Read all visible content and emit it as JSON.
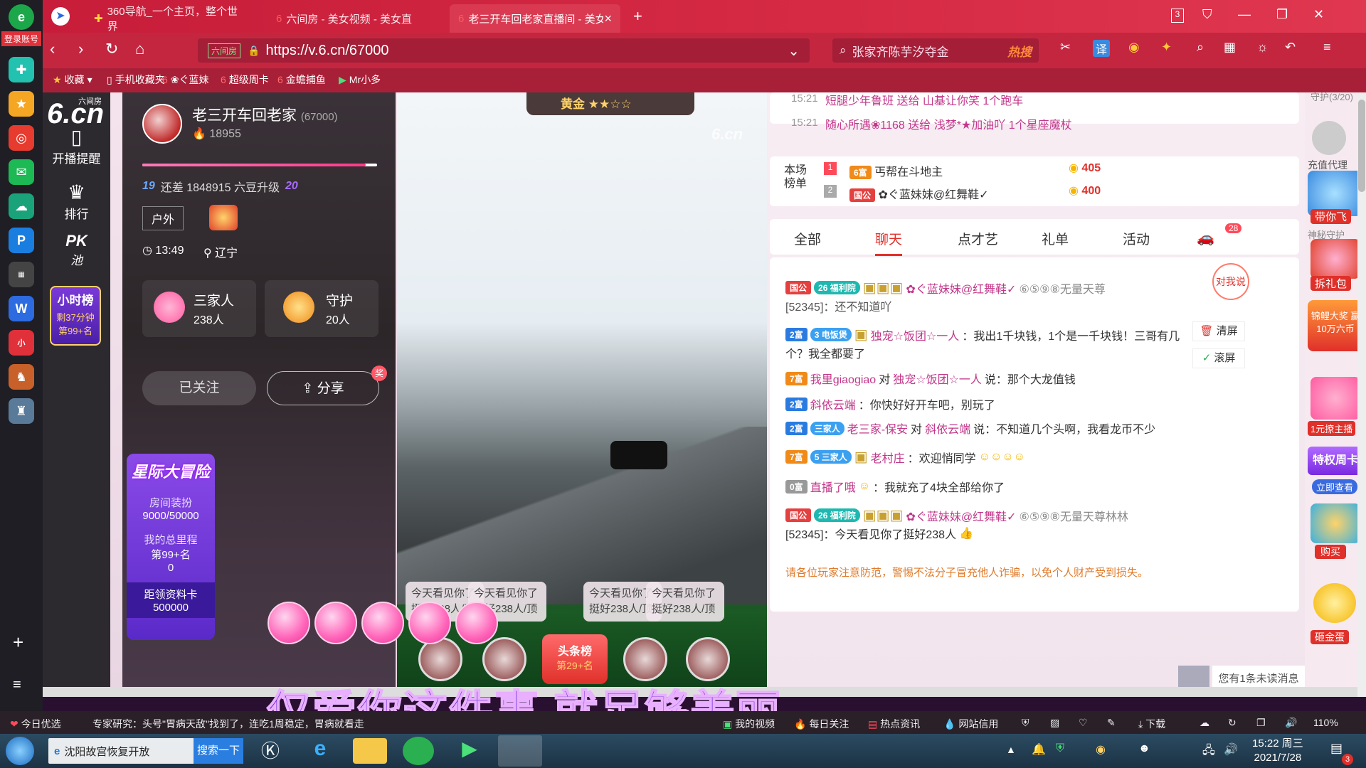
{
  "browser": {
    "login_label": "登录账号",
    "tabs": [
      {
        "label": "360导航_一个主页，整个世界"
      },
      {
        "label": "六间房 - 美女视频 - 美女直"
      },
      {
        "label": "老三开车回老家直播间 - 美女",
        "active": true
      }
    ],
    "tab_count": "3",
    "url_tag": "六间房",
    "url": "https://v.6.cn/67000",
    "search_text": "张家齐陈芋汐夺金",
    "search_hot": "热搜",
    "bookmarks": [
      "收藏",
      "手机收藏夹",
      "❀ぐ蓝妹",
      "超级周卡",
      "金蟾捕鱼",
      "Mr小多"
    ]
  },
  "sidenav": {
    "logo_small": "六间房",
    "logo": "6.cn",
    "items": [
      "开播提醒",
      "排行",
      "PK",
      "池"
    ],
    "hour_rank": {
      "title": "小时榜",
      "remaining": "剩37分钟",
      "rank": "第99+名"
    }
  },
  "anchor": {
    "name": "老三开车回老家",
    "room_id": "(67000)",
    "fans_count": "18955",
    "level_from": "19",
    "level_text": "还差 1848915 六豆升级",
    "level_to": "20",
    "tag": "户外",
    "time": "13:49",
    "location": "辽宁",
    "family": {
      "label": "三家人",
      "count": "238人"
    },
    "guard": {
      "label": "守护",
      "count": "20人"
    },
    "follow_label": "已关注",
    "share_label": "分享",
    "share_badge": "奖"
  },
  "adventure": {
    "title": "星际大冒险",
    "deco_label": "房间装扮",
    "deco_value": "9000/50000",
    "mileage_label": "我的总里程",
    "mileage_rank": "第99+名",
    "mileage_value": "0",
    "card_label": "距领资料卡",
    "card_value": "500000"
  },
  "video": {
    "rank_label": "黄金",
    "watermark": "6.cn",
    "bubbles": [
      "今天看见你了挺好238人/顶",
      "今天看见你了挺好238人/顶",
      "今天看见你了挺好238人/顶",
      "今天看见你了挺好238人/顶"
    ],
    "headline_label": "头条榜",
    "headline_rank": "第29+名",
    "lyric": "仅爱你这件事 就足够美丽"
  },
  "gift_log": [
    {
      "time": "15:21",
      "text": "短腿少年鲁班 送给 山基让你笑 1个跑车"
    },
    {
      "time": "15:21",
      "text": "随心所遇❀1168 送给 浅梦*★加油吖 1个星座魔杖"
    }
  ],
  "leaderboard": {
    "title": "本场榜单",
    "rows": [
      {
        "rank": "1",
        "badge": "6富",
        "name": "丐帮在斗地主",
        "score": "405"
      },
      {
        "rank": "2",
        "badge": "国公",
        "name": "✿ぐ蓝妹妹@红舞鞋✓",
        "score": "400"
      }
    ]
  },
  "chat_tabs": [
    {
      "label": "全部"
    },
    {
      "label": "聊天",
      "active": true
    },
    {
      "label": "点才艺"
    },
    {
      "label": "礼单"
    },
    {
      "label": "活动"
    }
  ],
  "chat_tab_badge": "28",
  "chat_tools": {
    "talk": "对我说",
    "clear": "清屏",
    "scroll": "滚屏"
  },
  "chat": [
    {
      "badge": "国公",
      "fan": "26 福利院",
      "name": "✿ぐ蓝妹妹@红舞鞋✓",
      "extra": "⑥⑤⑨⑧无量天尊",
      "line2": "[52345]：还不知道吖"
    },
    {
      "badge": "2富",
      "fan": "3 电饭煲",
      "name": "独宠☆饭团☆一人",
      "text": "：我出1千块钱，1个是一千块钱！三哥有几",
      "line2": "个？我全都要了"
    },
    {
      "badge": "7富",
      "name": "我里giaogiao",
      "mid": "对",
      "target": "独宠☆饭团☆一人",
      "text": "说：那个大龙值钱"
    },
    {
      "badge": "2富",
      "name": "斜依云端",
      "text": "：你快好好开车吧，别玩了"
    },
    {
      "badge": "2富",
      "fan": "三家人",
      "name": "老三家-保安",
      "mid": "对",
      "target": "斜依云端",
      "text": "说：不知道几个头啊，我看龙币不少"
    },
    {
      "badge": "7富",
      "fan": "5 三家人",
      "name": "老村庄",
      "text": "：欢迎悄同学"
    },
    {
      "badge": "0富",
      "name": "直播了哦",
      "text": "：我就充了4块全部给你了"
    },
    {
      "badge": "国公",
      "fan": "26 福利院",
      "name": "✿ぐ蓝妹妹@红舞鞋✓",
      "extra": "⑥⑤⑨⑧无量天尊林林",
      "line2": "[52345]：今天看见你了挺好238人"
    }
  ],
  "notice": "请各位玩家注意防范，警惕不法分子冒充他人诈骗，以免个人财产受到损失。",
  "unread": "您有1条未读消息",
  "gift_column": {
    "guard_header": "守护(3/20)",
    "items": [
      "充值代理",
      "带你飞",
      "神秘守护",
      "拆礼包",
      "锦鲤大奖 赢10万六币",
      "1元撩主播",
      "特权周卡",
      "立即查看",
      "购买",
      "砸金蛋"
    ]
  },
  "status_bar": {
    "items": [
      "今日优选",
      "专家研究：头号\"胃病天敌\"找到了，连吃1周稳定，胃病就看走",
      "我的视频",
      "每日关注",
      "热点资讯",
      "网站信用",
      "下载"
    ],
    "zoom": "110%"
  },
  "taskbar": {
    "browser_tab": "沈阳故宫恢复开放",
    "search_btn": "搜索一下",
    "time": "15:22 周三",
    "date": "2021/7/28",
    "notif": "3"
  }
}
